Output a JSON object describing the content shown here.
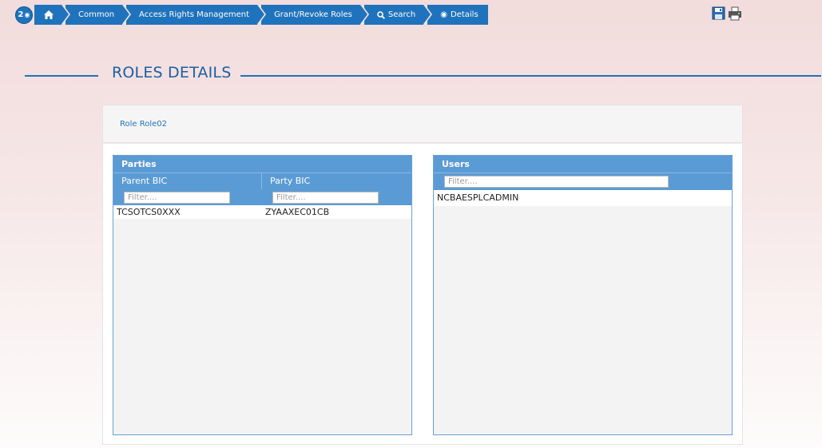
{
  "breadcrumb": {
    "badge_count": "2",
    "items": [
      {
        "label": ""
      },
      {
        "label": "Common"
      },
      {
        "label": "Access Rights Management"
      },
      {
        "label": "Grant/Revoke Roles"
      },
      {
        "label": "Search"
      },
      {
        "label": "Details"
      }
    ]
  },
  "toolbar": {
    "save_icon": "save-icon",
    "print_icon": "print-icon"
  },
  "section": {
    "title": "ROLES DETAILS"
  },
  "role": {
    "label": "Role Role02"
  },
  "parties": {
    "title": "Parties",
    "columns": [
      "Parent BIC",
      "Party BIC"
    ],
    "filter_placeholder": "Filter....",
    "rows": [
      [
        "TCSOTCS0XXX",
        "ZYAAXEC01CB"
      ]
    ]
  },
  "users": {
    "title": "Users",
    "filter_placeholder": "Filter....",
    "rows": [
      "NCBAESPLCADMIN"
    ]
  },
  "colors": {
    "accent": "#1f73bd",
    "grid_header": "#5b9bd5"
  }
}
